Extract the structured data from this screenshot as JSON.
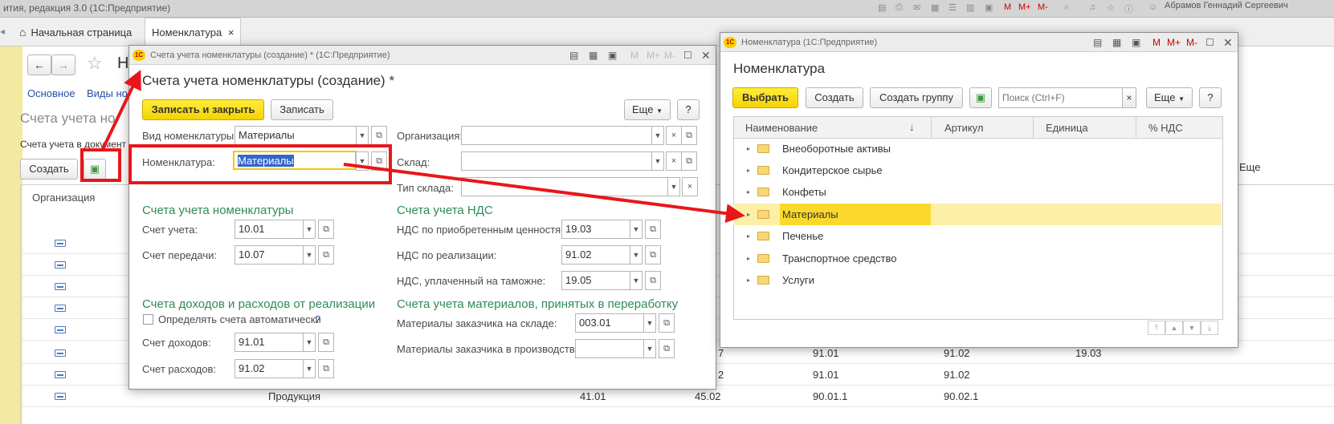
{
  "app": {
    "title": "ития, редакция 3.0  (1С:Предприятие)",
    "user": "Абрамов Геннадий Сергеевич",
    "toolbar_icons": [
      "doc-icon",
      "print-icon",
      "mail-icon",
      "calc-icon",
      "calendar-icon",
      "M",
      "M+",
      "M-",
      "search-icon",
      "bell-icon",
      "star-icon",
      "info-icon",
      "user-icon"
    ]
  },
  "tabs": [
    {
      "label": "Начальная страница",
      "icon": "home-icon"
    },
    {
      "label": "Номенклатура",
      "close": "×"
    }
  ],
  "bg_page": {
    "title_partial": "Н",
    "links": [
      "Основное",
      "Виды ном"
    ],
    "section_title": "Счета учета но",
    "note": "Счета учета в документ",
    "create_label": "Создать",
    "more_partial": "Еще",
    "column_org": "Организация",
    "rows": [
      {
        "c1": "",
        "c2": "",
        "c3": "",
        "c4": "",
        "c5": "",
        "c6": ""
      },
      {
        "c1": "",
        "c2": "",
        "c3": "",
        "c4": "",
        "c5": "",
        "c6": ""
      },
      {
        "c1": "",
        "c2": "",
        "c3": "",
        "c4": "",
        "c5": "",
        "c6": ""
      },
      {
        "c1": "",
        "c2": "",
        "c3": "",
        "c4": "",
        "c5": "",
        "c6": ""
      },
      {
        "c1": "",
        "c2": "",
        "c3": "",
        "c4": "",
        "c5": "",
        "c6": ""
      },
      {
        "c1": "",
        "c2": "7",
        "c3": "91.01",
        "c4": "91.02",
        "c5": "19.03",
        "c6": ""
      },
      {
        "c1": "",
        "c2": "2",
        "c3": "91.01",
        "c4": "91.02",
        "c5": "",
        "c6": ""
      },
      {
        "c1": "Продукция",
        "c2": "41.01",
        "c3": "45.02",
        "c4": "90.01.1",
        "c5": "90.02.1",
        "c6": ""
      }
    ]
  },
  "form": {
    "window_title": "Счета учета номенклатуры (создание) *  (1С:Предприятие)",
    "heading": "Счета учета номенклатуры (создание) *",
    "save_close_label": "Записать и закрыть",
    "save_label": "Записать",
    "more_label": "Еще",
    "help_label": "?",
    "vid_label": "Вид номенклатуры:",
    "vid_value": "Материалы",
    "nom_label": "Номенклатура:",
    "nom_value": "Материалы",
    "org_label": "Организация:",
    "org_value": "",
    "sklad_label": "Склад:",
    "sklad_value": "",
    "tip_label": "Тип склада:",
    "tip_value": "",
    "sec1_title": "Счета учета номенклатуры",
    "schet_label": "Счет учета:",
    "schet_value": "10.01",
    "peredachi_label": "Счет передачи:",
    "peredachi_value": "10.07",
    "sec2_title": "Счета учета НДС",
    "nds_pr_label": "НДС по приобретенным ценностям:",
    "nds_pr_value": "19.03",
    "nds_real_label": "НДС по реализации:",
    "nds_real_value": "91.02",
    "nds_tam_label": "НДС, уплаченный на таможне:",
    "nds_tam_value": "19.05",
    "sec3_title": "Счета доходов и расходов от реализации",
    "auto_label": "Определять счета автоматически",
    "auto_checked": false,
    "auto_help": "?",
    "dohod_label": "Счет доходов:",
    "dohod_value": "91.01",
    "rashod_label": "Счет расходов:",
    "rashod_value": "91.02",
    "sec4_title": "Счета учета материалов, принятых в переработку",
    "zak_sklad_label": "Материалы заказчика на складе:",
    "zak_sklad_value": "003.01",
    "zak_proizv_label": "Материалы заказчика в производстве:",
    "zak_proizv_value": ""
  },
  "picker": {
    "window_title": "Номенклатура  (1С:Предприятие)",
    "heading": "Номенклатура",
    "select_label": "Выбрать",
    "create_label": "Создать",
    "create_group_label": "Создать группу",
    "search_placeholder": "Поиск (Ctrl+F)",
    "more_label": "Еще",
    "help_label": "?",
    "columns": [
      "Наименование",
      "Артикул",
      "Единица",
      "% НДС"
    ],
    "sort_indicator": "↓",
    "rows": [
      {
        "name": "Внеоборотные активы",
        "selected": false
      },
      {
        "name": "Кондитерское сырье",
        "selected": false
      },
      {
        "name": "Конфеты",
        "selected": false
      },
      {
        "name": "Материалы",
        "selected": true
      },
      {
        "name": "Печенье",
        "selected": false
      },
      {
        "name": "Транспортное средство",
        "selected": false
      },
      {
        "name": "Услуги",
        "selected": false
      }
    ]
  },
  "colors": {
    "accent_yellow": "#f5d300",
    "selection_yellow": "#fce34a",
    "annotation_red": "#e8161b",
    "section_green": "#2e8b57"
  }
}
